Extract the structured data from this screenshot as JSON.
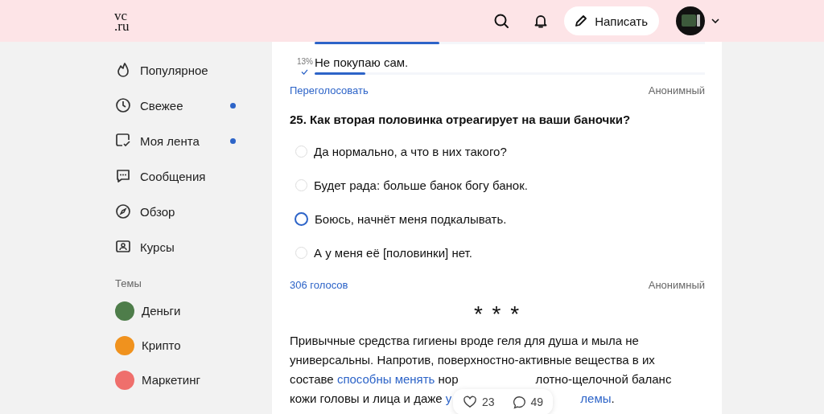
{
  "header": {
    "logo_top": "vc",
    "logo_bottom": ".ru",
    "write_button": "Написать"
  },
  "sidebar": {
    "items": [
      {
        "label": "Популярное",
        "unread": false
      },
      {
        "label": "Свежее",
        "unread": true
      },
      {
        "label": "Моя лента",
        "unread": true
      },
      {
        "label": "Сообщения",
        "unread": false
      },
      {
        "label": "Обзор",
        "unread": false
      },
      {
        "label": "Курсы",
        "unread": false
      }
    ],
    "topics_heading": "Темы",
    "topics": [
      {
        "label": "Деньги",
        "color": "#4e7d4a"
      },
      {
        "label": "Крипто",
        "color": "#f0921e"
      },
      {
        "label": "Маркетинг",
        "color": "#ef6f6c"
      }
    ]
  },
  "prev_poll": {
    "results": [
      {
        "level": 0.32
      },
      {
        "percent": "13%",
        "label": "Не покупаю сам.",
        "voted": true,
        "level": 0.13
      }
    ],
    "revote": "Переголосовать",
    "mode": "Анонимный"
  },
  "poll": {
    "question": "25. Как вторая половинка отреагирует на ваши баночки?",
    "options": [
      {
        "label": "Да нормально, а что в них такого?",
        "hovered": false
      },
      {
        "label": "Будет рада: больше банок богу банок.",
        "hovered": false
      },
      {
        "label": "Боюсь, начнёт меня подкалывать.",
        "hovered": true
      },
      {
        "label": "А у меня её [половинки] нет.",
        "hovered": false
      }
    ],
    "votes": "306 голосов",
    "mode": "Анонимный"
  },
  "separator": "* * *",
  "paragraph": [
    [
      {
        "kind": "text",
        "text": "Привычные средства гигиены вроде геля для душа и мыла не"
      }
    ],
    [
      {
        "kind": "text",
        "text": "универсальны. Напротив, поверхностно-активные вещества в их"
      }
    ],
    [
      {
        "kind": "text",
        "text": "составе "
      },
      {
        "kind": "link",
        "text": "способны менять"
      },
      {
        "kind": "text",
        "text": " нор"
      },
      {
        "kind": "covered"
      },
      {
        "kind": "text",
        "text": "лотно-щелочной баланс"
      }
    ],
    [
      {
        "kind": "text",
        "text": "кожи головы и лица и даже "
      },
      {
        "kind": "link",
        "text": "у"
      },
      {
        "kind": "covered"
      },
      {
        "kind": "link",
        "text": "лемы"
      },
      {
        "kind": "text",
        "text": "."
      }
    ]
  ],
  "reactions": {
    "likes": "23",
    "comments": "49"
  }
}
